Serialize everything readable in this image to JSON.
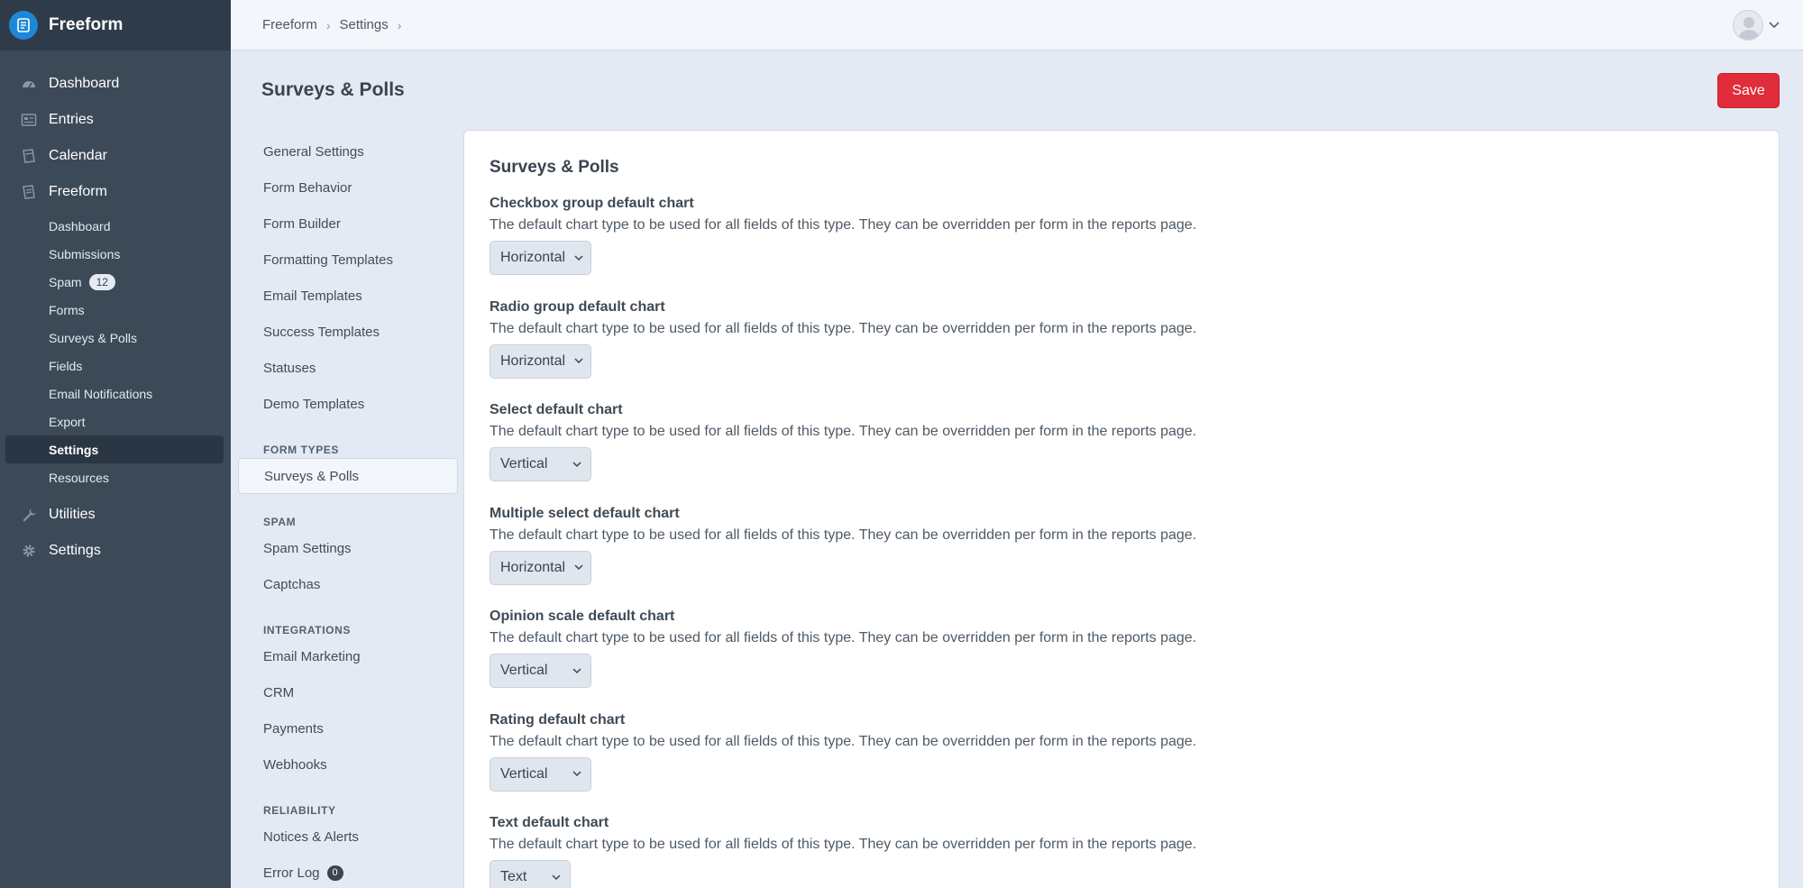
{
  "brand": {
    "name": "Freeform"
  },
  "global_nav": {
    "items": [
      {
        "label": "Dashboard",
        "icon": "dashboard-icon"
      },
      {
        "label": "Entries",
        "icon": "entries-icon"
      },
      {
        "label": "Calendar",
        "icon": "calendar-icon"
      },
      {
        "label": "Freeform",
        "icon": "freeform-icon"
      }
    ],
    "sub_items": [
      {
        "label": "Dashboard"
      },
      {
        "label": "Submissions"
      },
      {
        "label": "Spam",
        "badge": "12"
      },
      {
        "label": "Forms"
      },
      {
        "label": "Surveys & Polls"
      },
      {
        "label": "Fields"
      },
      {
        "label": "Email Notifications"
      },
      {
        "label": "Export"
      },
      {
        "label": "Settings",
        "active": true
      },
      {
        "label": "Resources"
      }
    ],
    "bottom_items": [
      {
        "label": "Utilities",
        "icon": "wrench-icon"
      },
      {
        "label": "Settings",
        "icon": "gear-icon"
      }
    ]
  },
  "breadcrumb": [
    "Freeform",
    "Settings"
  ],
  "page": {
    "title": "Surveys & Polls",
    "save_label": "Save"
  },
  "settings_nav": {
    "main": [
      "General Settings",
      "Form Behavior",
      "Form Builder",
      "Formatting Templates",
      "Email Templates",
      "Success Templates",
      "Statuses",
      "Demo Templates"
    ],
    "form_types_heading": "FORM TYPES",
    "form_types": [
      "Surveys & Polls"
    ],
    "spam_heading": "SPAM",
    "spam": [
      "Spam Settings",
      "Captchas"
    ],
    "integrations_heading": "INTEGRATIONS",
    "integrations": [
      "Email Marketing",
      "CRM",
      "Payments",
      "Webhooks"
    ],
    "reliability_heading": "RELIABILITY",
    "reliability": [
      {
        "label": "Notices & Alerts"
      },
      {
        "label": "Error Log",
        "badge": "0"
      }
    ]
  },
  "panel": {
    "title": "Surveys & Polls",
    "fields": [
      {
        "label": "Checkbox group default chart",
        "description": "The default chart type to be used for all fields of this type. They can be overridden per form in the reports page.",
        "value": "Horizontal"
      },
      {
        "label": "Radio group default chart",
        "description": "The default chart type to be used for all fields of this type. They can be overridden per form in the reports page.",
        "value": "Horizontal"
      },
      {
        "label": "Select default chart",
        "description": "The default chart type to be used for all fields of this type. They can be overridden per form in the reports page.",
        "value": "Vertical"
      },
      {
        "label": "Multiple select default chart",
        "description": "The default chart type to be used for all fields of this type. They can be overridden per form in the reports page.",
        "value": "Horizontal"
      },
      {
        "label": "Opinion scale default chart",
        "description": "The default chart type to be used for all fields of this type. They can be overridden per form in the reports page.",
        "value": "Vertical"
      },
      {
        "label": "Rating default chart",
        "description": "The default chart type to be used for all fields of this type. They can be overridden per form in the reports page.",
        "value": "Vertical"
      },
      {
        "label": "Text default chart",
        "description": "The default chart type to be used for all fields of this type. They can be overridden per form in the reports page.",
        "value": "Text"
      }
    ]
  },
  "colors": {
    "sidebar": "#3c4a58",
    "brand_bar": "#2f3b48",
    "save": "#e12d39",
    "logo": "#1e88d8"
  }
}
